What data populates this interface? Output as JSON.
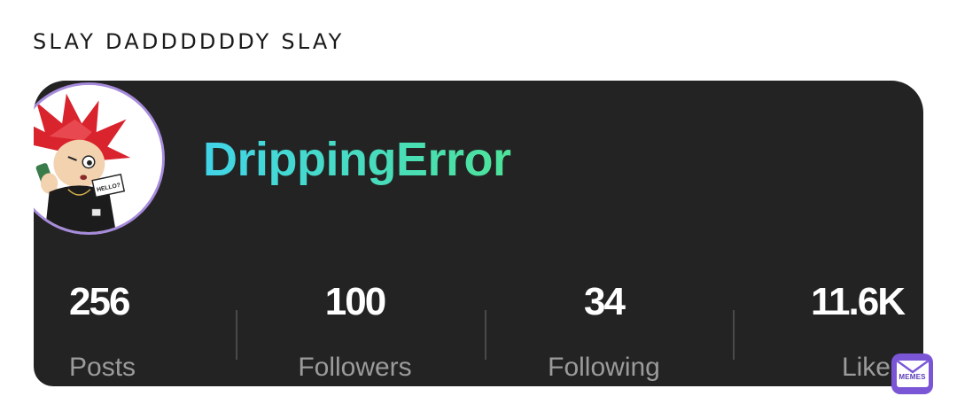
{
  "caption": "SLAY DADDDDDDY SLAY",
  "profile": {
    "username": "DrippingError",
    "gradient": [
      "#41d4e8",
      "#4de39a"
    ],
    "avatar_icon": "anime-character-avatar",
    "avatar_speech": "HELLO?"
  },
  "stats": [
    {
      "value": "256",
      "label": "Posts"
    },
    {
      "value": "100",
      "label": "Followers"
    },
    {
      "value": "34",
      "label": "Following"
    },
    {
      "value": "11.6K",
      "label": "Likes"
    }
  ],
  "watermark": {
    "text": "MEMES",
    "color": "#7a56d6"
  },
  "colors": {
    "card_bg": "#232323",
    "avatar_ring": "#a78bdc",
    "label_gray": "#9b9b9b"
  }
}
